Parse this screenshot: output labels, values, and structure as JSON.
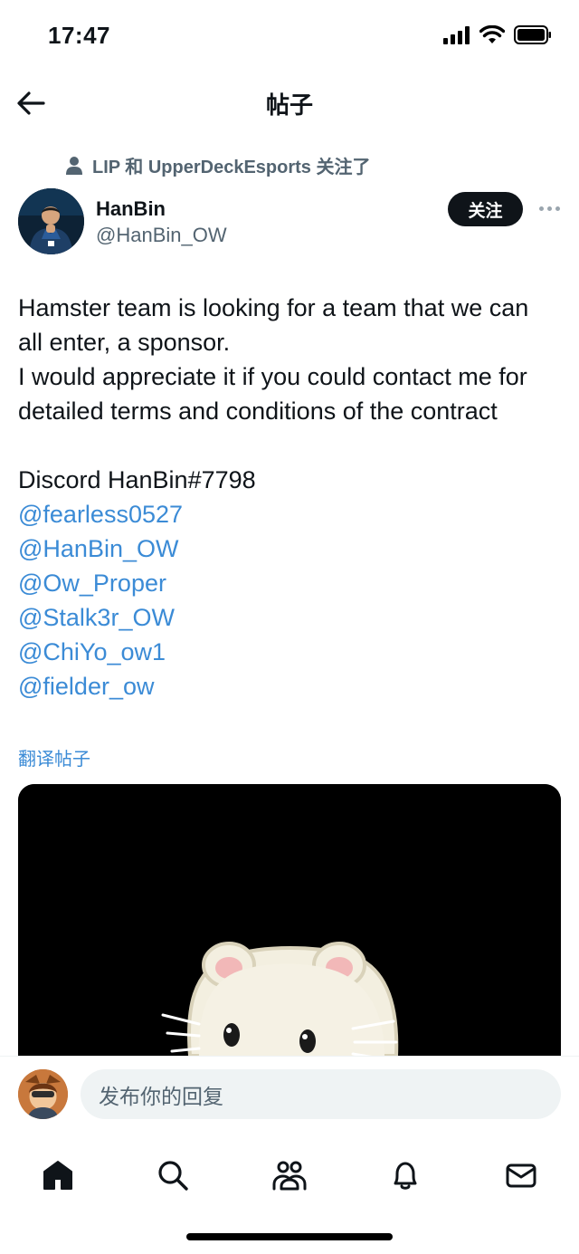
{
  "status_bar": {
    "time": "17:47"
  },
  "header": {
    "title": "帖子"
  },
  "social_context": {
    "text": "LIP 和 UpperDeckEsports 关注了"
  },
  "author": {
    "name": "HanBin",
    "handle": "@HanBin_OW",
    "follow_label": "关注"
  },
  "post": {
    "lines": [
      "Hamster team is looking for a team that we can",
      "all enter, a sponsor.",
      "I would appreciate it if you could contact me for",
      "detailed terms and conditions of the contract"
    ],
    "discord_line": "Discord HanBin#7798",
    "mentions": [
      "@fearless0527",
      "@HanBin_OW",
      "@Ow_Proper",
      "@Stalk3r_OW",
      "@ChiYo_ow1",
      "@fielder_ow"
    ],
    "translate_label": "翻译帖子"
  },
  "reply": {
    "placeholder": "发布你的回复"
  },
  "nav": {
    "items": [
      "home-icon",
      "search-icon",
      "communities-icon",
      "notifications-icon",
      "messages-icon"
    ]
  },
  "colors": {
    "link": "#3b8bd6",
    "text": "#0f1419",
    "secondary": "#536471"
  }
}
